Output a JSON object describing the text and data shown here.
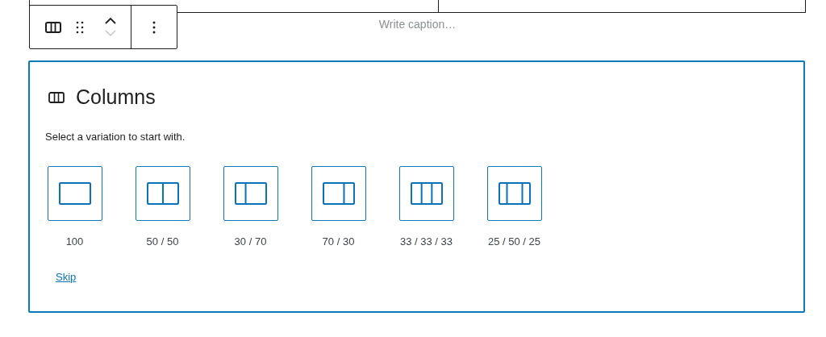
{
  "caption": {
    "placeholder": "Write caption…"
  },
  "toolbar": {
    "move_up_disabled": false,
    "move_down_disabled": true
  },
  "block": {
    "title": "Columns",
    "instructions": "Select a variation to start with.",
    "variations": [
      {
        "label": "100",
        "kind": "full"
      },
      {
        "label": "50 / 50",
        "kind": "halves"
      },
      {
        "label": "30 / 70",
        "kind": "narrowwide"
      },
      {
        "label": "70 / 30",
        "kind": "widenarrow"
      },
      {
        "label": "33 / 33 / 33",
        "kind": "thirds"
      },
      {
        "label": "25 / 50 / 25",
        "kind": "widecenter"
      }
    ],
    "skip": "Skip"
  }
}
